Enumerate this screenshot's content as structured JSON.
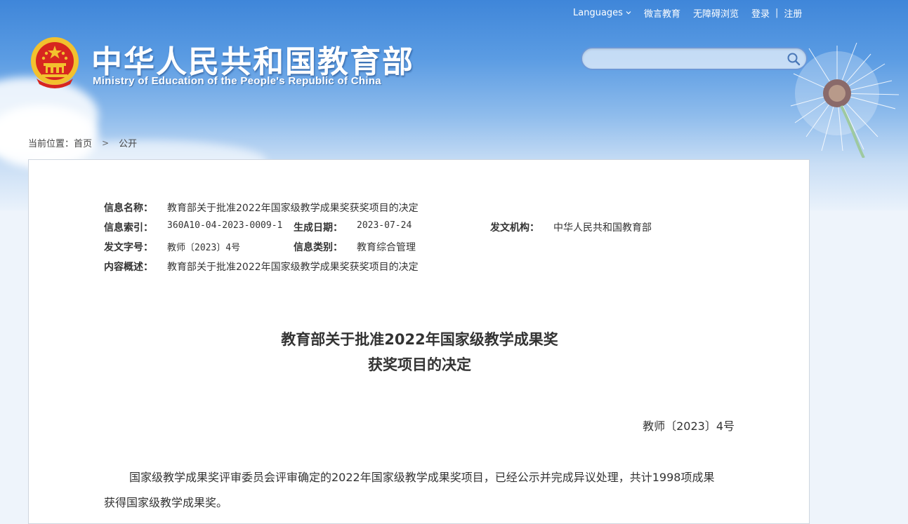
{
  "header": {
    "title_cn": "中华人民共和国教育部",
    "title_en": "Ministry of Education of the People's Republic of China",
    "nav": {
      "languages": "Languages",
      "weiyan": "微言教育",
      "accessible": "无障碍浏览",
      "login": "登录",
      "separator": "|",
      "register": "注册"
    },
    "search": {
      "value": "",
      "placeholder": ""
    }
  },
  "breadcrumb": {
    "prefix": "当前位置：",
    "home": "首页",
    "arrow": ">",
    "current": "公开"
  },
  "meta": {
    "info_name_label": "信息名称：",
    "info_name": "教育部关于批准2022年国家级教学成果奖获奖项目的决定",
    "index_label": "信息索引：",
    "index": "360A10-04-2023-0009-1",
    "date_label": "生成日期：",
    "date": "2023-07-24",
    "issuer_label": "发文机构：",
    "issuer": "中华人民共和国教育部",
    "doc_no_label": "发文字号：",
    "doc_no": "教师〔2023〕4号",
    "category_label": "信息类别：",
    "category": "教育综合管理",
    "summary_label": "内容概述：",
    "summary": "教育部关于批准2022年国家级教学成果奖获奖项目的决定"
  },
  "document": {
    "title_line1": "教育部关于批准2022年国家级教学成果奖",
    "title_line2": "获奖项目的决定",
    "doc_no": "教师〔2023〕4号",
    "paragraph1": "国家级教学成果奖评审委员会评审确定的2022年国家级教学成果奖项目，已经公示并完成异议处理，共计1998项成果获得国家级教学成果奖。"
  },
  "colors": {
    "banner_top": "#3f86d9",
    "emblem_red": "#d7261f",
    "emblem_gold": "#f2c12e",
    "text": "#333333"
  },
  "icons": {
    "emblem": "national-emblem-icon",
    "search": "search-icon",
    "chevron": "chevron-down-icon",
    "decor": "dandelion-icon"
  }
}
